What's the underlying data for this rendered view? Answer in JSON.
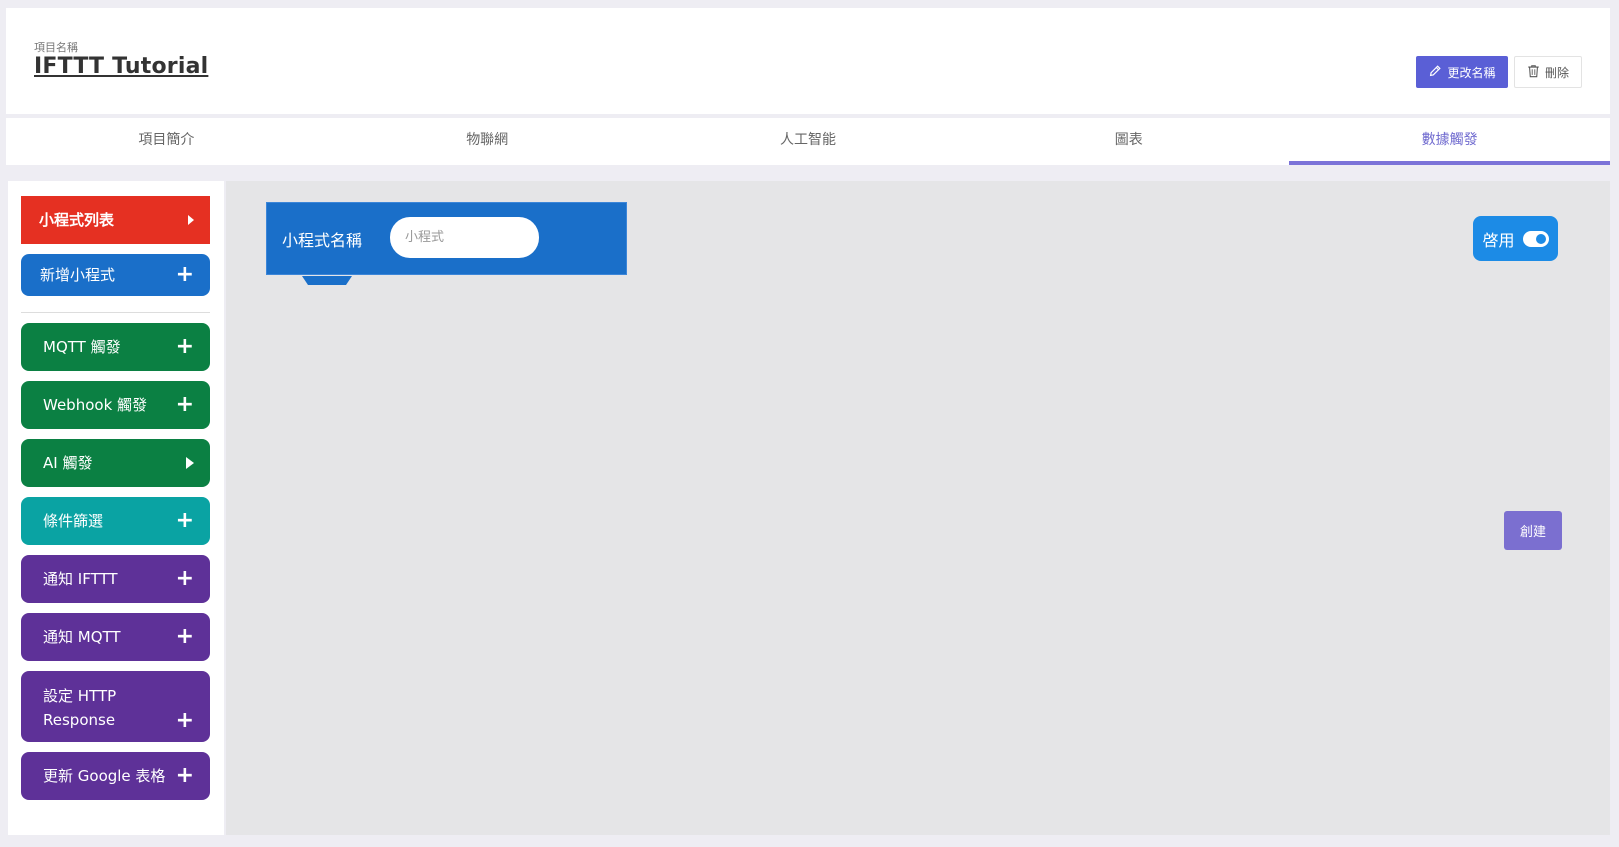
{
  "header": {
    "project_label": "項目名稱",
    "project_title": "IFTTT Tutorial",
    "rename_label": "更改名稱",
    "delete_label": "刪除"
  },
  "tabs": [
    {
      "label": "項目簡介"
    },
    {
      "label": "物聯網"
    },
    {
      "label": "人工智能"
    },
    {
      "label": "圖表"
    },
    {
      "label": "數據觸發",
      "active": true
    }
  ],
  "sidebar": {
    "items": [
      {
        "label": "小程式列表",
        "color": "#e53022",
        "icon": "triangle-right-icon"
      },
      {
        "label": "新增小程式",
        "color": "#1a6fc9",
        "icon": "plus-icon"
      },
      {
        "label": "MQTT 觸發",
        "color": "#0b8043",
        "icon": "plus-icon"
      },
      {
        "label": "Webhook 觸發",
        "color": "#0b8043",
        "icon": "plus-icon"
      },
      {
        "label": "AI 觸發",
        "color": "#0b8043",
        "icon": "triangle-right-icon"
      },
      {
        "label": "條件篩選",
        "color": "#0aa3a3",
        "icon": "plus-icon"
      },
      {
        "label": "通知 IFTTT",
        "color": "#5e3198",
        "icon": "plus-icon"
      },
      {
        "label": "通知 MQTT",
        "color": "#5e3198",
        "icon": "plus-icon"
      },
      {
        "label": "設定 HTTP Response",
        "color": "#5e3198",
        "icon": "plus-icon"
      },
      {
        "label": "更新 Google 表格",
        "color": "#5e3198",
        "icon": "plus-icon"
      }
    ]
  },
  "workspace": {
    "block": {
      "label": "小程式名稱",
      "input_placeholder": "小程式"
    },
    "enable_label": "啓用",
    "create_label": "創建"
  },
  "colors": {
    "accent": "#7b73d8",
    "rename_button": "#5a5fd6",
    "block_blue": "#1a6fc9",
    "toggle_blue": "#1c8be6",
    "create_button": "#7b6fd0"
  }
}
